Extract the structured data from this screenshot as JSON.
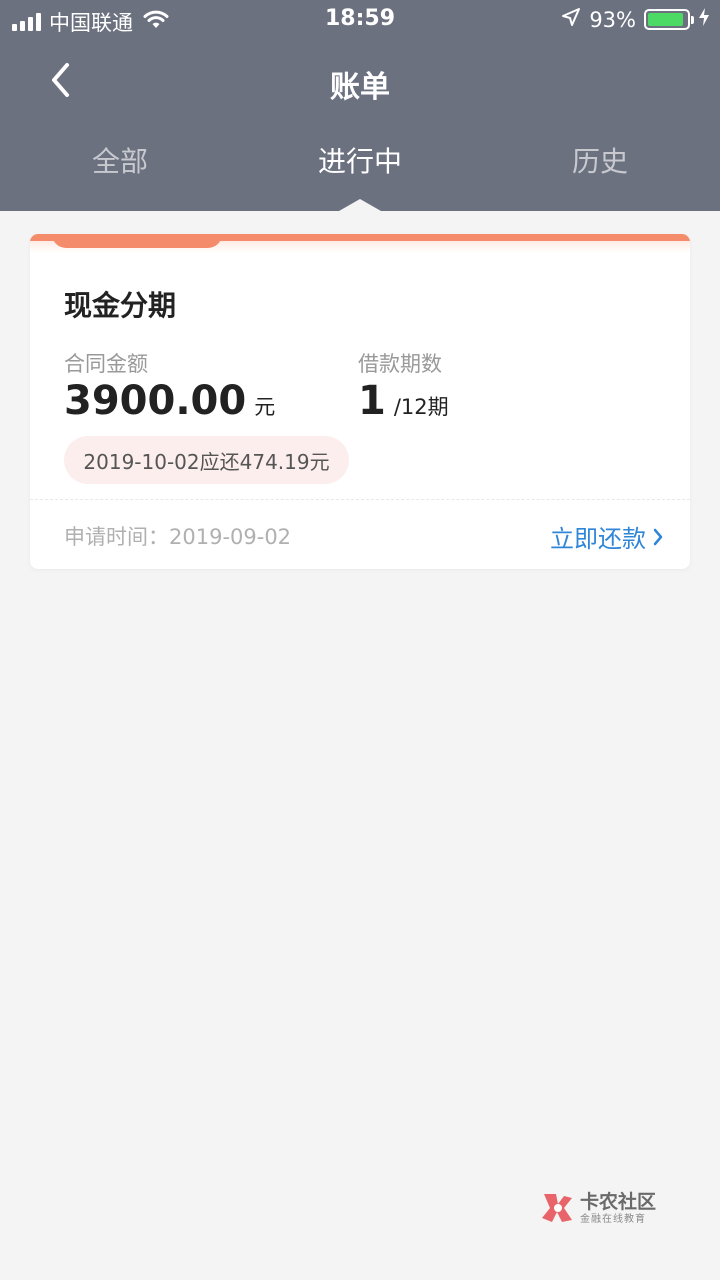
{
  "status_bar": {
    "carrier": "中国联通",
    "time": "18:59",
    "battery": "93%",
    "battery_level": 0.93
  },
  "header": {
    "title": "账单"
  },
  "tabs": [
    {
      "label": "全部",
      "active": false
    },
    {
      "label": "进行中",
      "active": true
    },
    {
      "label": "历史",
      "active": false
    }
  ],
  "bill_card": {
    "title": "现金分期",
    "contract_label": "合同金额",
    "contract_amount": "3900.00",
    "contract_unit": "元",
    "term_label": "借款期数",
    "term_current": "1",
    "term_total": "/12期",
    "due_notice": "2019-10-02应还474.19元",
    "apply_time": "申请时间：2019-09-02",
    "pay_label": "立即还款"
  },
  "watermark": {
    "name": "卡农社区",
    "subtitle": "金融在线教育"
  },
  "colors": {
    "header_bg": "#6c7180",
    "accent_orange": "#f48b6a",
    "link_blue": "#2f86d8",
    "page_bg": "#f4f4f4"
  }
}
